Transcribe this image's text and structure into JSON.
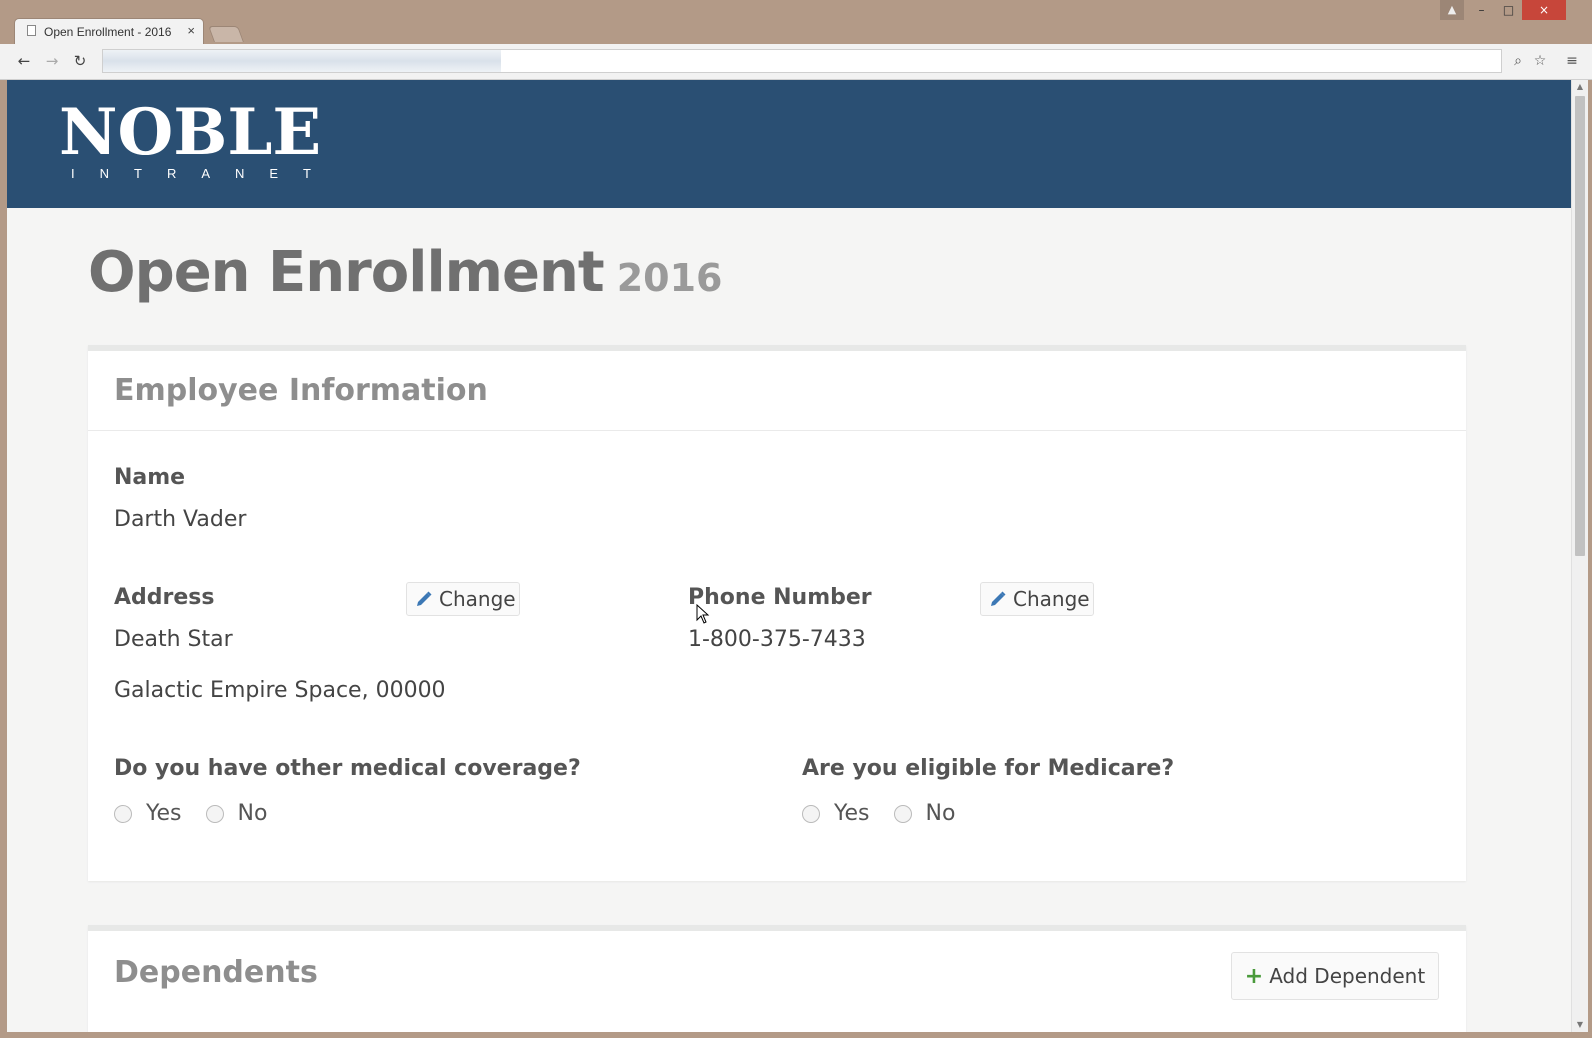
{
  "browser": {
    "tab_title": "Open Enrollment - 2016",
    "tab_close": "×",
    "back_icon": "←",
    "forward_icon": "→",
    "reload_icon": "↻",
    "zoom_icon": "⌕",
    "star_icon": "☆",
    "menu_icon": "≡",
    "minimize": "–",
    "maximize": "□",
    "close": "×",
    "user_icon": "▲"
  },
  "brand": {
    "logo_main": "NOBLE",
    "logo_sub": "INTRANET",
    "bar_color": "#2a4f73"
  },
  "page": {
    "title": "Open Enrollment",
    "year": "2016"
  },
  "employee": {
    "section_title": "Employee Information",
    "name_label": "Name",
    "name_value": "Darth Vader",
    "address_label": "Address",
    "address_line1": "Death Star",
    "address_line2": "Galactic Empire Space, 00000",
    "change_label": "Change",
    "phone_label": "Phone Number",
    "phone_value": "1-800-375-7433",
    "coverage_question": "Do you have other medical coverage?",
    "medicare_question": "Are you eligible for Medicare?",
    "yes_label": "Yes",
    "no_label": "No"
  },
  "dependents": {
    "section_title": "Dependents",
    "add_label": "Add Dependent",
    "add_icon": "+"
  }
}
